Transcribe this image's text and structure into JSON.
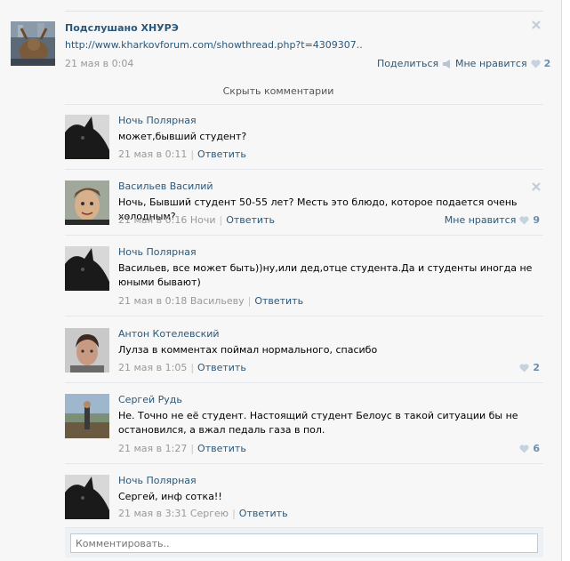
{
  "post": {
    "author": "Подслушано ХНУРЭ",
    "link": "http://www.kharkovforum.com/showthread.php?t=4309307..",
    "date": "21 мая в 0:04",
    "share_label": "Поделиться",
    "like_label": "Мне нравится",
    "like_count": "2"
  },
  "hide_comments_label": "Скрыть комментарии",
  "comments": [
    {
      "author": "Ночь Полярная",
      "text": "может,бывший студент?",
      "date": "21 мая в 0:11",
      "to": "",
      "reply": "Ответить"
    },
    {
      "author": "Васильев Василий",
      "text": "Ночь, Бывший студент 50-55 лет? Месть это блюдо, которое подается очень холодным?",
      "date": "21 мая в 0:16",
      "to": "Ночи",
      "reply": "Ответить",
      "like_label": "Мне нравится",
      "like_count": "9"
    },
    {
      "author": "Ночь Полярная",
      "text": "Васильев, все может быть))ну,или дед,отце студента.Да и студенты иногда не юными бывают)",
      "date": "21 мая в 0:18",
      "to": "Васильеву",
      "reply": "Ответить"
    },
    {
      "author": "Антон Котелевский",
      "text": "Лулза в комментах поймал нормального, спасибо",
      "date": "21 мая в 1:05",
      "to": "",
      "reply": "Ответить",
      "like_count": "2"
    },
    {
      "author": "Сергей Рудь",
      "text": "Не. Точно не её студент. Настоящий студент Белоус в такой ситуации бы не остановился, а вжал педаль газа в пол.",
      "date": "21 мая в 1:27",
      "to": "",
      "reply": "Ответить",
      "like_count": "6"
    },
    {
      "author": "Ночь Полярная",
      "text": "Сергей, инф сотка!!",
      "date": "21 мая в 3:31",
      "to": "Сергею",
      "reply": "Ответить"
    }
  ],
  "comment_input": {
    "placeholder": "Комментировать.."
  },
  "colors": {
    "link": "#2b587a",
    "muted": "#999999",
    "like_count": "#6b8db0"
  }
}
